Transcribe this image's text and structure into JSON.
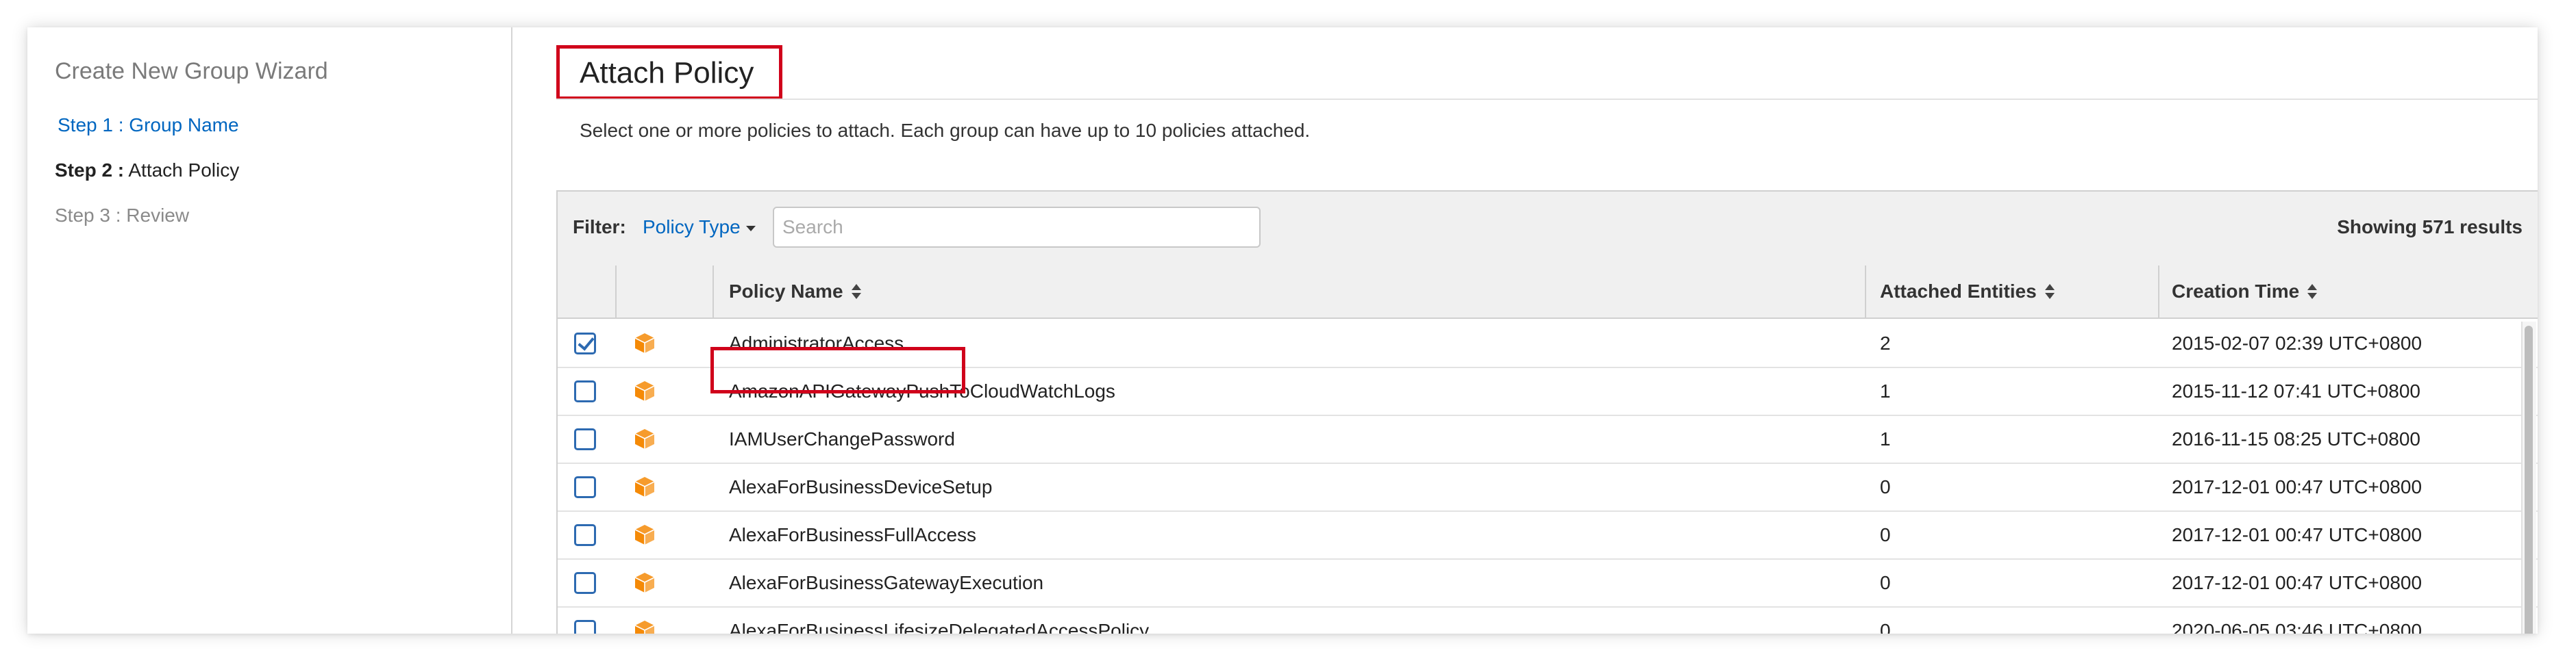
{
  "sidebar": {
    "title": "Create New Group Wizard",
    "steps": [
      {
        "label": "Step 1 : Group Name"
      },
      {
        "prefix": "Step 2 :",
        "label": " Attach Policy"
      },
      {
        "label": "Step 3 : Review"
      }
    ]
  },
  "main": {
    "title": "Attach Policy",
    "description": "Select one or more policies to attach. Each group can have up to 10 policies attached."
  },
  "filter": {
    "label": "Filter:",
    "policy_type": "Policy Type",
    "search_placeholder": "Search",
    "results": "Showing 571 results"
  },
  "table": {
    "columns": [
      "Policy Name",
      "Attached Entities",
      "Creation Time"
    ],
    "rows": [
      {
        "name": "AdministratorAccess",
        "entities": "2",
        "time": "2015-02-07 02:39 UTC+0800",
        "checked": true
      },
      {
        "name": "AmazonAPIGatewayPushToCloudWatchLogs",
        "entities": "1",
        "time": "2015-11-12 07:41 UTC+0800",
        "checked": false
      },
      {
        "name": "IAMUserChangePassword",
        "entities": "1",
        "time": "2016-11-15 08:25 UTC+0800",
        "checked": false
      },
      {
        "name": "AlexaForBusinessDeviceSetup",
        "entities": "0",
        "time": "2017-12-01 00:47 UTC+0800",
        "checked": false
      },
      {
        "name": "AlexaForBusinessFullAccess",
        "entities": "0",
        "time": "2017-12-01 00:47 UTC+0800",
        "checked": false
      },
      {
        "name": "AlexaForBusinessGatewayExecution",
        "entities": "0",
        "time": "2017-12-01 00:47 UTC+0800",
        "checked": false
      },
      {
        "name": "AlexaForBusinessLifesizeDelegatedAccessPolicy",
        "entities": "0",
        "time": "2020-06-05 03:46 UTC+0800",
        "checked": false
      }
    ]
  },
  "colors": {
    "link": "#0066c0",
    "highlight": "#d0021b",
    "checkbox": "#2d6ab1",
    "policy_icon": "#f58a07"
  },
  "icons": {
    "policy": "aws-managed-policy-cube-icon",
    "sort": "sort-icon",
    "caret": "caret-down-icon"
  }
}
